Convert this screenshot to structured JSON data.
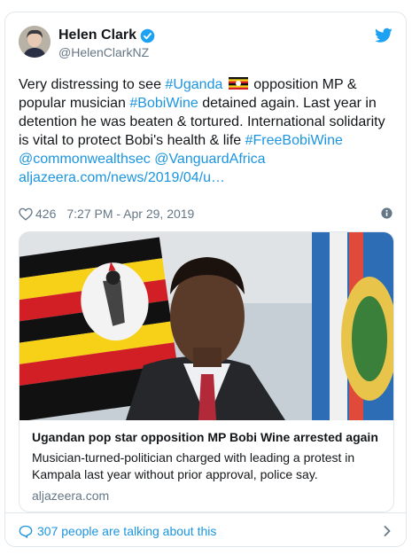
{
  "author": {
    "name": "Helen Clark",
    "handle": "@HelenClarkNZ"
  },
  "tweet": {
    "segments": [
      {
        "text": "Very distressing to see ",
        "type": "text"
      },
      {
        "text": "#Uganda",
        "type": "link"
      },
      {
        "text": " ",
        "type": "text"
      },
      {
        "text": "flag-uganda",
        "type": "flag"
      },
      {
        "text": " opposition MP & popular musician ",
        "type": "text"
      },
      {
        "text": "#BobiWine",
        "type": "link"
      },
      {
        "text": " detained again. Last year in detention he was beaten & tortured. International solidarity is vital to protect Bobi's health & life ",
        "type": "text"
      },
      {
        "text": "#FreeBobiWine",
        "type": "link"
      },
      {
        "text": " ",
        "type": "text"
      },
      {
        "text": "@commonwealthsec",
        "type": "link"
      },
      {
        "text": " ",
        "type": "text"
      },
      {
        "text": "@VanguardAfrica",
        "type": "link"
      },
      {
        "text": " ",
        "type": "text"
      },
      {
        "text": "aljazeera.com/news/2019/04/u…",
        "type": "link"
      }
    ]
  },
  "meta": {
    "likes": "426",
    "timestamp": "7:27 PM - Apr 29, 2019"
  },
  "link_card": {
    "title": "Ugandan pop star opposition MP Bobi Wine arrested again",
    "description": "Musician-turned-politician charged with leading a protest in Kampala last year without prior approval, police say.",
    "domain": "aljazeera.com"
  },
  "footer": {
    "talking_text": "307 people are talking about this"
  },
  "colors": {
    "link": "#1b95e0",
    "muted": "#657786",
    "border": "#e1e8ed",
    "twitter_blue": "#1da1f2"
  },
  "icons": [
    "verified-badge-icon",
    "twitter-bird-icon",
    "heart-icon",
    "info-icon",
    "reply-bubble-icon",
    "chevron-right-icon",
    "uganda-flag-icon"
  ]
}
